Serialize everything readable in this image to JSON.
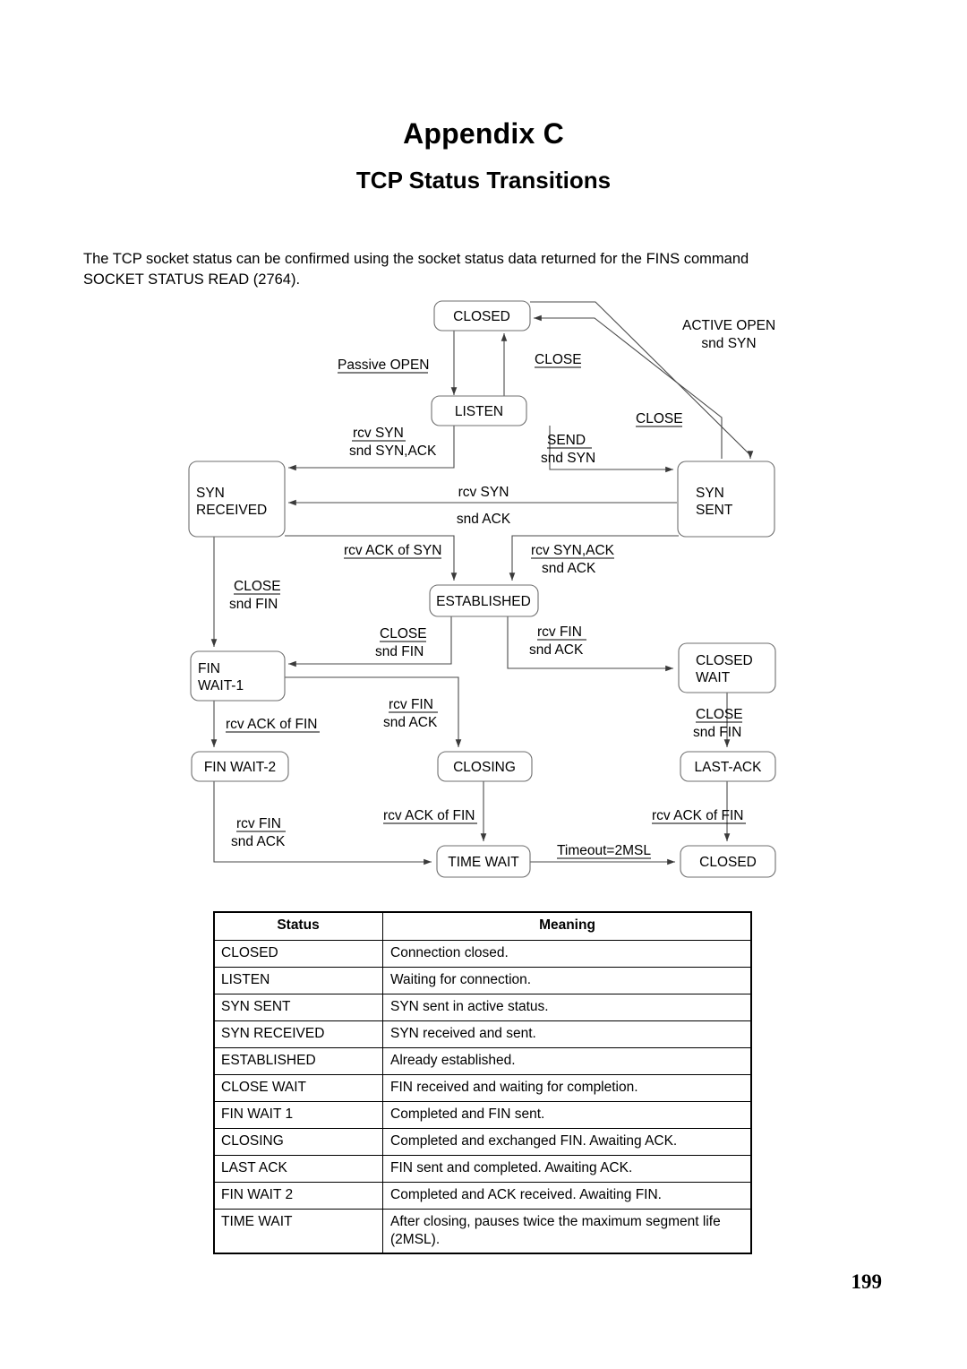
{
  "document": {
    "appendix_title": "Appendix C",
    "subtitle": "TCP Status Transitions",
    "intro_line1": "The TCP socket status can be confirmed using the socket status data returned for the FINS command",
    "intro_line2": "SOCKET STATUS READ (2764).",
    "page_number": "199"
  },
  "diagram": {
    "states": {
      "closed_top": "CLOSED",
      "listen": "LISTEN",
      "syn_received_l1": "SYN",
      "syn_received_l2": "RECEIVED",
      "syn_sent_l1": "SYN",
      "syn_sent_l2": "SENT",
      "established": "ESTABLISHED",
      "fin_wait_1_l1": "FIN",
      "fin_wait_1_l2": "WAIT-1",
      "closed_wait_l1": "CLOSED",
      "closed_wait_l2": "WAIT",
      "fin_wait_2": "FIN WAIT-2",
      "closing": "CLOSING",
      "last_ack": "LAST-ACK",
      "time_wait": "TIME WAIT",
      "closed_bottom": "CLOSED"
    },
    "edges": {
      "passive_open": "Passive OPEN",
      "active_open_l1": "ACTIVE OPEN",
      "active_open_l2": "snd SYN",
      "close_listen_to_closed": "CLOSE",
      "close_synsent_to_closed": "CLOSE",
      "rcv_syn_snd_synack_l1": "rcv SYN",
      "rcv_syn_snd_synack_l2": "snd SYN,ACK",
      "send_snd_syn_l1": "SEND",
      "send_snd_syn_l2": "snd SYN",
      "rcv_syn_l1": "rcv SYN",
      "rcv_syn_l2": "snd ACK",
      "rcv_ack_of_syn": "rcv ACK of SYN",
      "rcv_synack_l1": "rcv SYN,ACK",
      "rcv_synack_l2": "snd ACK",
      "close_snd_fin_left_l1": "CLOSE",
      "close_snd_fin_left_l2": "snd FIN",
      "close_snd_fin_est_l1": "CLOSE",
      "close_snd_fin_est_l2": "snd FIN",
      "rcv_fin_snd_ack_est_l1": "rcv FIN",
      "rcv_fin_snd_ack_est_l2": "snd ACK",
      "rcv_ack_of_fin_fw1": "rcv ACK of FIN",
      "rcv_fin_snd_ack_fw1_l1": "rcv FIN",
      "rcv_fin_snd_ack_fw1_l2": "snd ACK",
      "close_snd_fin_cw_l1": "CLOSE",
      "close_snd_fin_cw_l2": "snd FIN",
      "rcv_fin_snd_ack_fw2_l1": "rcv FIN",
      "rcv_fin_snd_ack_fw2_l2": "snd ACK",
      "rcv_ack_of_fin_closing": "rcv ACK of FIN",
      "rcv_ack_of_fin_lastack": "rcv ACK of FIN",
      "timeout_2msl": "Timeout=2MSL"
    }
  },
  "table": {
    "headers": [
      "Status",
      "Meaning"
    ],
    "rows": [
      [
        "CLOSED",
        "Connection closed."
      ],
      [
        "LISTEN",
        "Waiting for connection."
      ],
      [
        "SYN SENT",
        "SYN sent in active status."
      ],
      [
        "SYN RECEIVED",
        "SYN received and sent."
      ],
      [
        "ESTABLISHED",
        "Already established."
      ],
      [
        "CLOSE WAIT",
        "FIN received and waiting for completion."
      ],
      [
        "FIN WAIT 1",
        "Completed and FIN sent."
      ],
      [
        "CLOSING",
        "Completed and exchanged FIN. Awaiting ACK."
      ],
      [
        "LAST ACK",
        "FIN sent and completed. Awaiting ACK."
      ],
      [
        "FIN WAIT 2",
        "Completed and ACK received. Awaiting FIN."
      ],
      [
        "TIME WAIT",
        "After closing, pauses twice the maximum segment life (2MSL)."
      ]
    ]
  }
}
